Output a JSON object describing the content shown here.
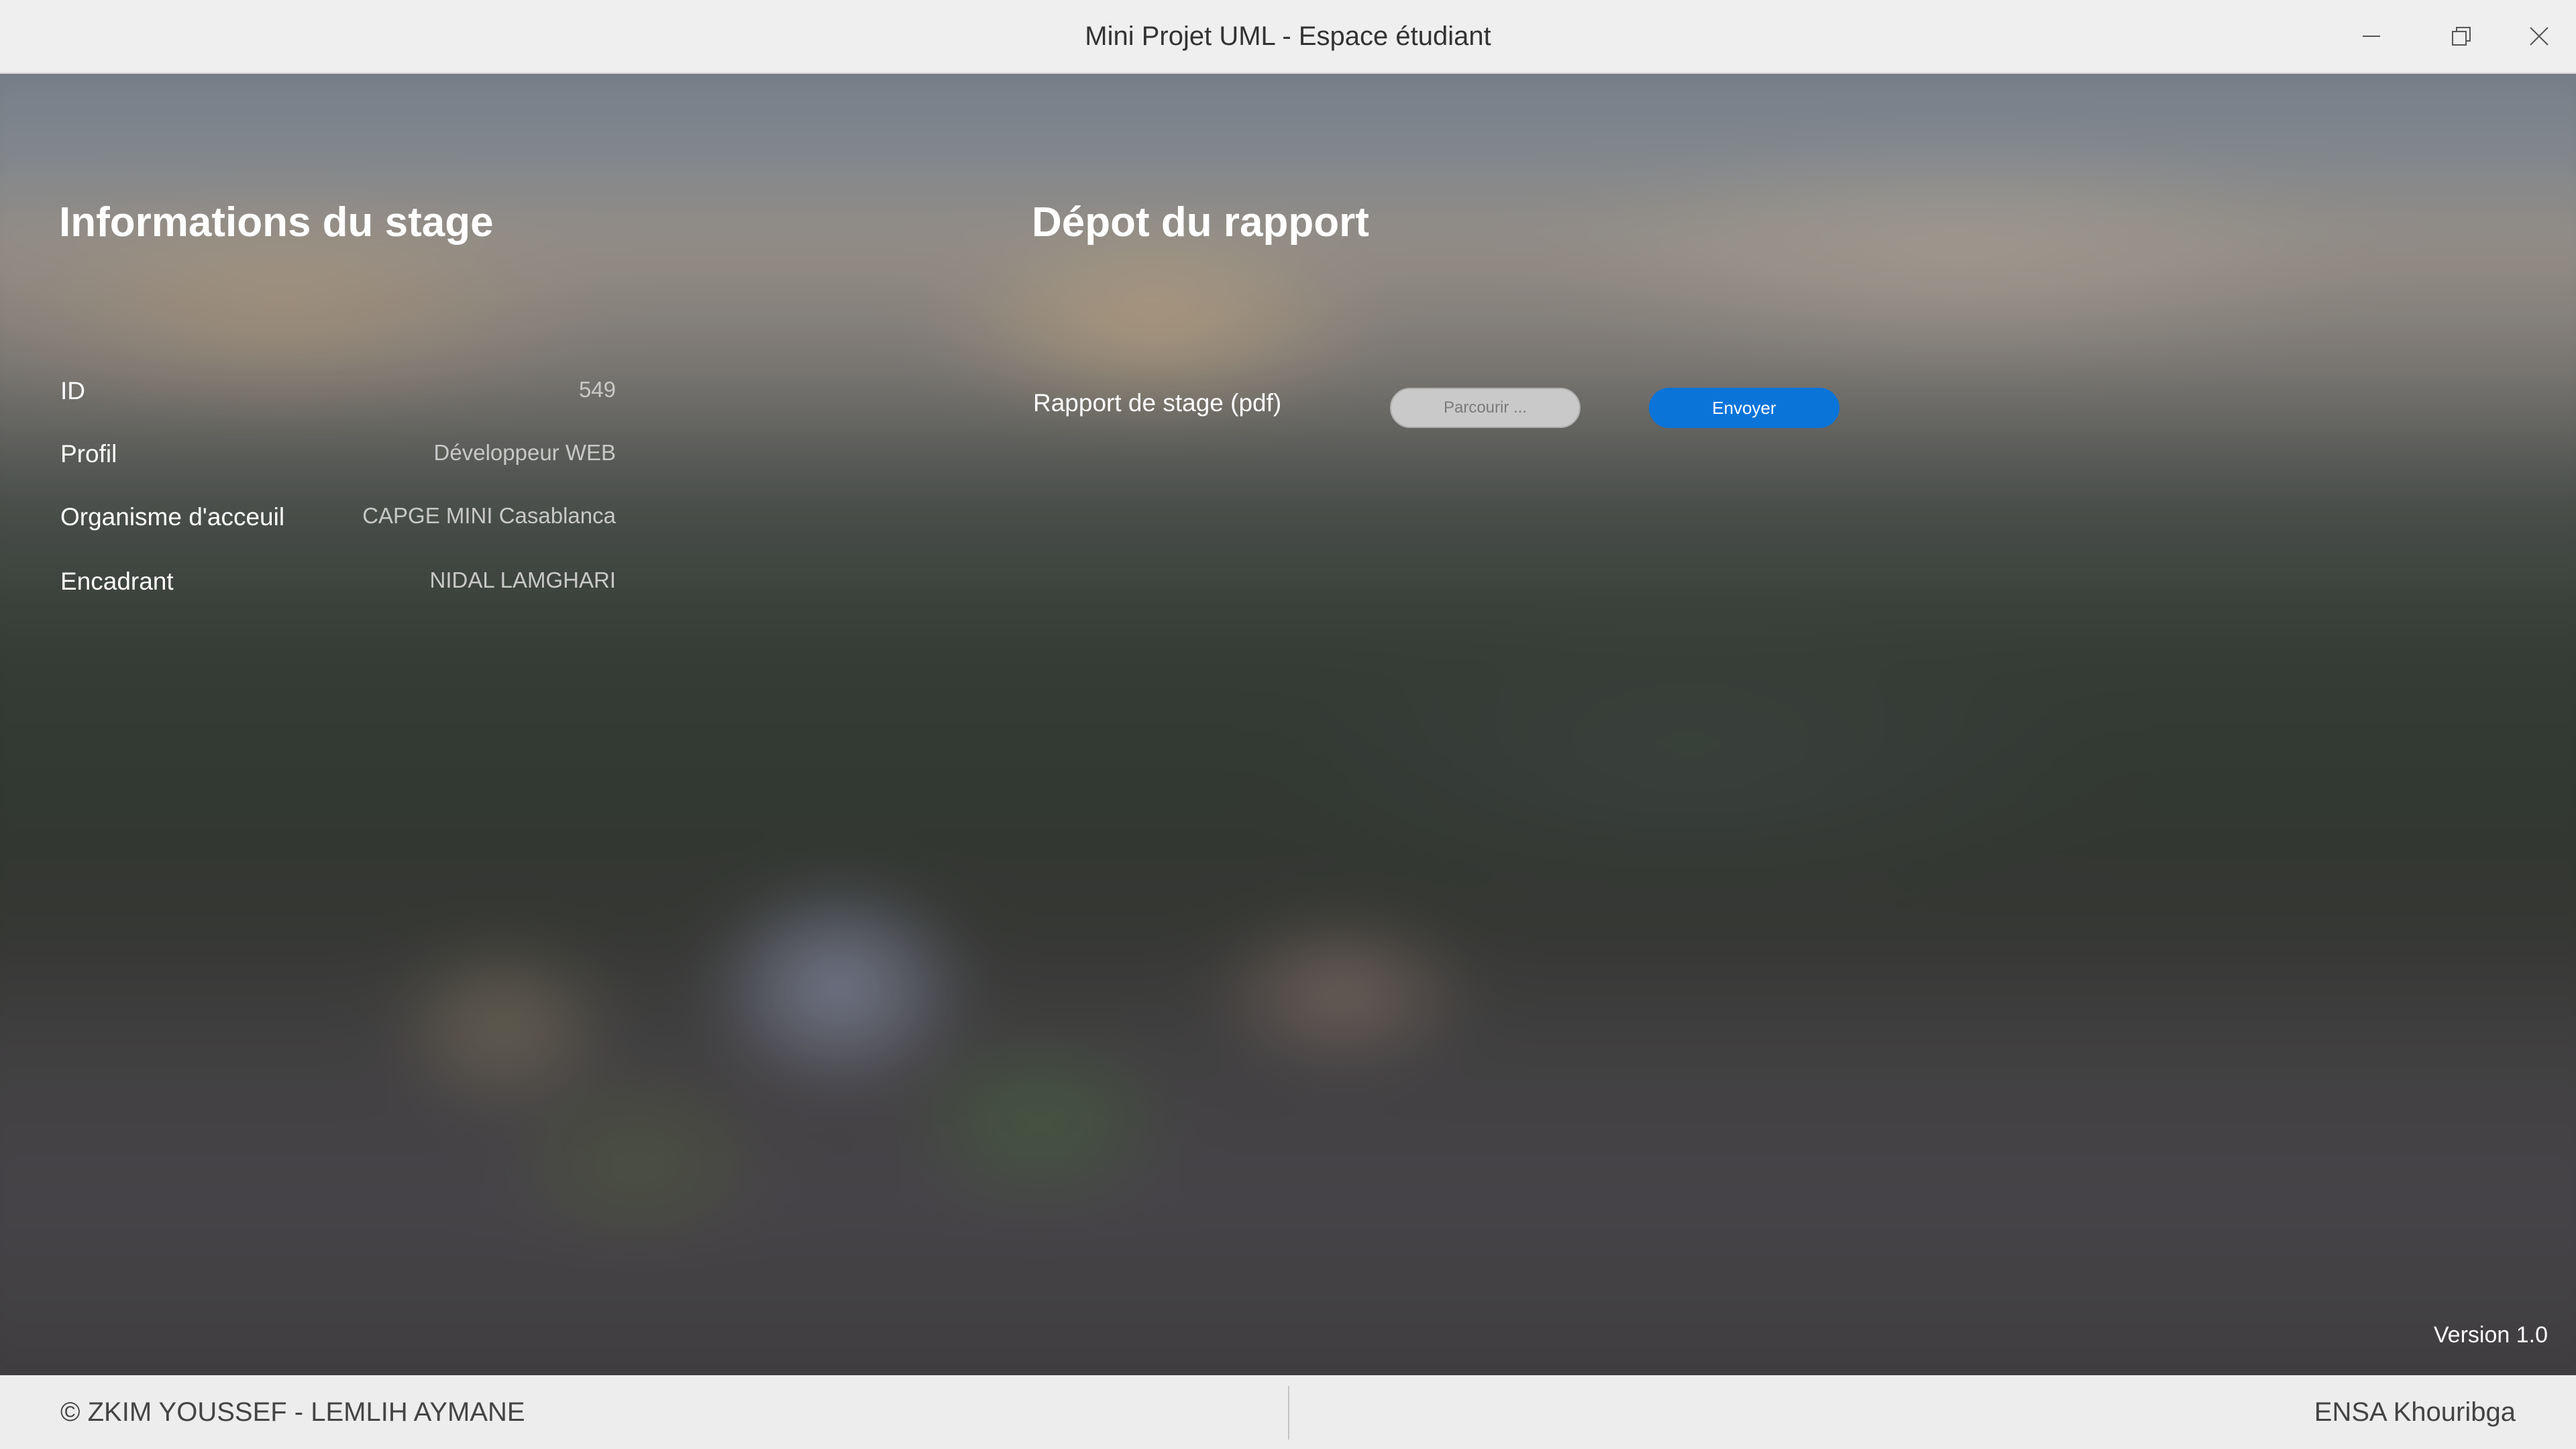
{
  "window": {
    "title": "Mini Projet UML - Espace étudiant",
    "controls": [
      "minimize-icon",
      "restore-icon",
      "close-icon"
    ]
  },
  "internship_info": {
    "heading": "Informations du stage",
    "fields": [
      {
        "label": "ID",
        "value": "549"
      },
      {
        "label": "Profil",
        "value": "Développeur WEB"
      },
      {
        "label": "Organisme d'acceuil",
        "value": "CAPGE MINI Casablanca"
      },
      {
        "label": "Encadrant",
        "value": "NIDAL LAMGHARI"
      }
    ]
  },
  "report_upload": {
    "heading": "Dépot du rapport",
    "label": "Rapport de stage (pdf)",
    "browse_label": "Parcourir ...",
    "send_label": "Envoyer"
  },
  "version": "Version 1.0",
  "footer": {
    "left": "© ZKIM YOUSSEF - LEMLIH AYMANE",
    "right": "ENSA Khouribga"
  },
  "colors": {
    "accent": "#0a74d9",
    "titlebar": "#efefef",
    "footer": "#ededed"
  }
}
